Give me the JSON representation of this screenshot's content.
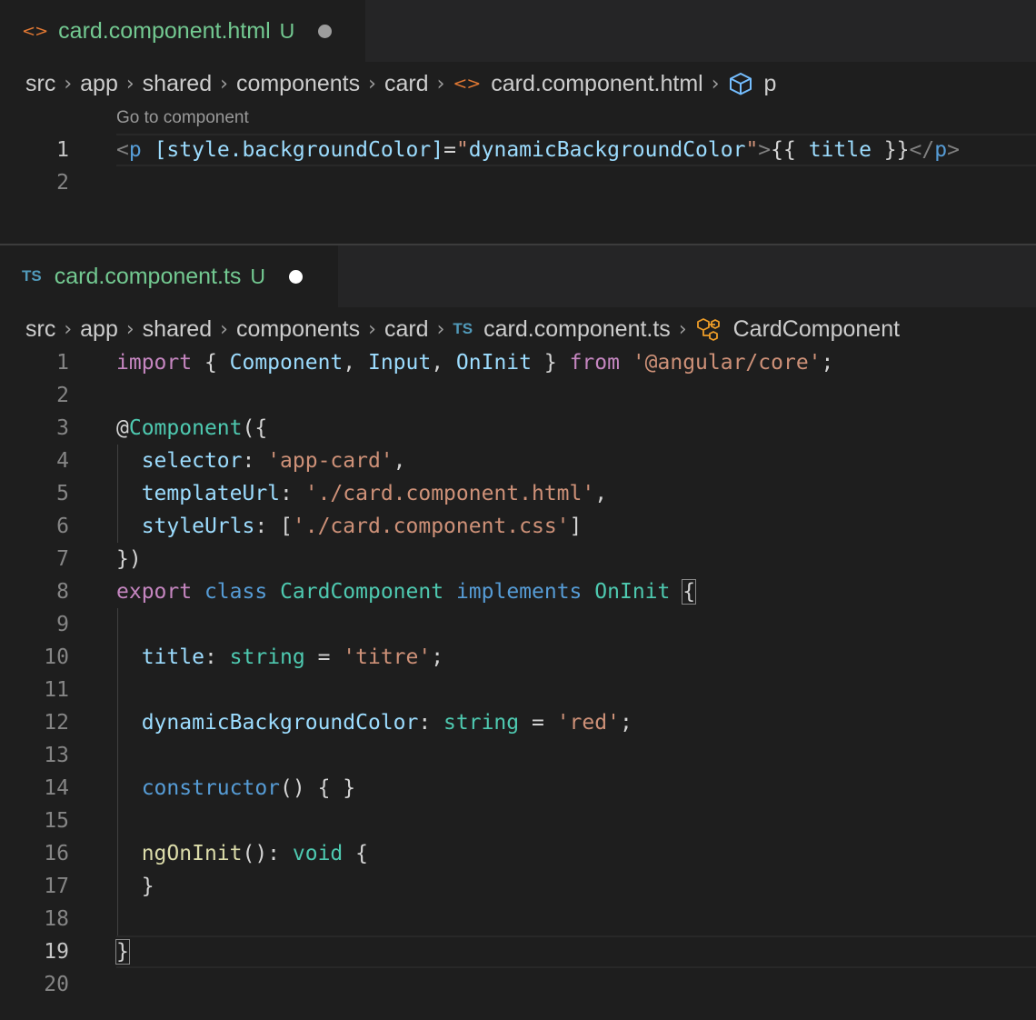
{
  "html_editor": {
    "tab": {
      "icon": "html-file-icon",
      "title": "card.component.html",
      "badge": "U"
    },
    "breadcrumb": [
      "src",
      "app",
      "shared",
      "components",
      "card",
      "card.component.html",
      "p"
    ],
    "codelens": "Go to component",
    "line_numbers": [
      "1",
      "2"
    ],
    "lines": [
      [
        {
          "t": "<",
          "c": "tagp"
        },
        {
          "t": "p",
          "c": "stor"
        },
        {
          "t": " ",
          "c": "punc"
        },
        {
          "t": "[style.backgroundColor]",
          "c": "attr"
        },
        {
          "t": "=",
          "c": "punc"
        },
        {
          "t": "\"",
          "c": "dq"
        },
        {
          "t": "dynamicBackgroundColor",
          "c": "var"
        },
        {
          "t": "\"",
          "c": "dq"
        },
        {
          "t": ">",
          "c": "tagp"
        },
        {
          "t": "{{ ",
          "c": "punc"
        },
        {
          "t": "title",
          "c": "var"
        },
        {
          "t": " }}",
          "c": "punc"
        },
        {
          "t": "</",
          "c": "tagp"
        },
        {
          "t": "p",
          "c": "stor"
        },
        {
          "t": ">",
          "c": "tagp"
        }
      ],
      []
    ]
  },
  "ts_editor": {
    "tab": {
      "icon": "typescript-file-icon",
      "icon_text": "TS",
      "title": "card.component.ts",
      "badge": "U"
    },
    "breadcrumb": [
      "src",
      "app",
      "shared",
      "components",
      "card",
      "card.component.ts",
      "CardComponent"
    ],
    "line_numbers": [
      "1",
      "2",
      "3",
      "4",
      "5",
      "6",
      "7",
      "8",
      "9",
      "10",
      "11",
      "12",
      "13",
      "14",
      "15",
      "16",
      "17",
      "18",
      "19",
      "20"
    ],
    "active_line": 19,
    "lines": [
      [
        {
          "t": "import",
          "c": "kw"
        },
        {
          "t": " { ",
          "c": "punc"
        },
        {
          "t": "Component",
          "c": "var"
        },
        {
          "t": ", ",
          "c": "punc"
        },
        {
          "t": "Input",
          "c": "var"
        },
        {
          "t": ", ",
          "c": "punc"
        },
        {
          "t": "OnInit",
          "c": "var"
        },
        {
          "t": " } ",
          "c": "punc"
        },
        {
          "t": "from",
          "c": "kw"
        },
        {
          "t": " ",
          "c": "punc"
        },
        {
          "t": "'@angular/core'",
          "c": "str"
        },
        {
          "t": ";",
          "c": "punc"
        }
      ],
      [],
      [
        {
          "t": "@",
          "c": "punc"
        },
        {
          "t": "Component",
          "c": "type"
        },
        {
          "t": "({",
          "c": "punc"
        }
      ],
      [
        {
          "t": "  ",
          "c": "punc"
        },
        {
          "t": "selector",
          "c": "var"
        },
        {
          "t": ": ",
          "c": "punc"
        },
        {
          "t": "'app-card'",
          "c": "str"
        },
        {
          "t": ",",
          "c": "punc"
        }
      ],
      [
        {
          "t": "  ",
          "c": "punc"
        },
        {
          "t": "templateUrl",
          "c": "var"
        },
        {
          "t": ": ",
          "c": "punc"
        },
        {
          "t": "'./card.component.html'",
          "c": "str"
        },
        {
          "t": ",",
          "c": "punc"
        }
      ],
      [
        {
          "t": "  ",
          "c": "punc"
        },
        {
          "t": "styleUrls",
          "c": "var"
        },
        {
          "t": ": [",
          "c": "punc"
        },
        {
          "t": "'./card.component.css'",
          "c": "str"
        },
        {
          "t": "]",
          "c": "punc"
        }
      ],
      [
        {
          "t": "})",
          "c": "punc"
        }
      ],
      [
        {
          "t": "export",
          "c": "kw"
        },
        {
          "t": " ",
          "c": "punc"
        },
        {
          "t": "class",
          "c": "stor"
        },
        {
          "t": " ",
          "c": "punc"
        },
        {
          "t": "CardComponent",
          "c": "type"
        },
        {
          "t": " ",
          "c": "punc"
        },
        {
          "t": "implements",
          "c": "stor"
        },
        {
          "t": " ",
          "c": "punc"
        },
        {
          "t": "OnInit",
          "c": "type"
        },
        {
          "t": " ",
          "c": "punc"
        },
        {
          "t": "{",
          "c": "punc",
          "box": true
        }
      ],
      [],
      [
        {
          "t": "  ",
          "c": "punc"
        },
        {
          "t": "title",
          "c": "var"
        },
        {
          "t": ": ",
          "c": "punc"
        },
        {
          "t": "string",
          "c": "type"
        },
        {
          "t": " = ",
          "c": "punc"
        },
        {
          "t": "'titre'",
          "c": "str"
        },
        {
          "t": ";",
          "c": "punc"
        }
      ],
      [],
      [
        {
          "t": "  ",
          "c": "punc"
        },
        {
          "t": "dynamicBackgroundColor",
          "c": "var"
        },
        {
          "t": ": ",
          "c": "punc"
        },
        {
          "t": "string",
          "c": "type"
        },
        {
          "t": " = ",
          "c": "punc"
        },
        {
          "t": "'red'",
          "c": "str"
        },
        {
          "t": ";",
          "c": "punc"
        }
      ],
      [],
      [
        {
          "t": "  ",
          "c": "punc"
        },
        {
          "t": "constructor",
          "c": "stor"
        },
        {
          "t": "() { }",
          "c": "punc"
        }
      ],
      [],
      [
        {
          "t": "  ",
          "c": "punc"
        },
        {
          "t": "ngOnInit",
          "c": "fn"
        },
        {
          "t": "(): ",
          "c": "punc"
        },
        {
          "t": "void",
          "c": "type"
        },
        {
          "t": " {",
          "c": "punc"
        }
      ],
      [
        {
          "t": "  }",
          "c": "punc"
        }
      ],
      [],
      [
        {
          "t": "}",
          "c": "punc",
          "box": true
        }
      ],
      []
    ]
  },
  "colors": {
    "background": "#1e1e1e",
    "tab_bar": "#252526",
    "untracked_green": "#73c991",
    "html_icon_orange": "#e37933",
    "ts_icon_blue": "#519aba",
    "keyword": "#c586c0",
    "storage": "#569cd6",
    "type": "#4ec9b0",
    "variable": "#9cdcfe",
    "string": "#ce9178",
    "function": "#dcdcaa"
  }
}
